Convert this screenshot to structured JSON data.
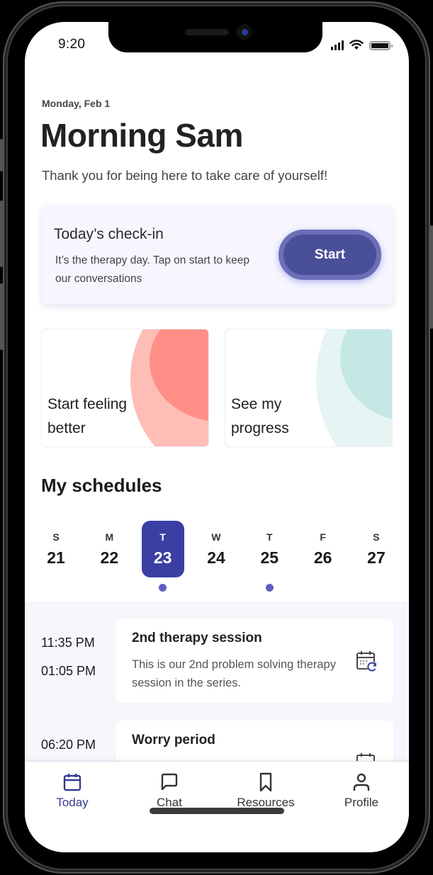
{
  "status_bar": {
    "time": "9:20",
    "icons": [
      "cellular-signal-icon",
      "wifi-icon",
      "battery-icon"
    ]
  },
  "header": {
    "date": "Monday, Feb 1",
    "greeting": "Morning Sam",
    "subtitle": "Thank you for being here to take care of yourself!"
  },
  "checkin": {
    "title": "Today’s check-in",
    "description": "It’s the therapy day. Tap on start to keep our conversations",
    "button_label": "Start"
  },
  "tiles": [
    {
      "label": "Start feeling better",
      "accent": "#ff8f86",
      "accent_light": "#ffbdb7"
    },
    {
      "label": "See my progress",
      "accent": "#c5e8e4",
      "accent_light": "#e6f5f3"
    }
  ],
  "schedules": {
    "title": "My schedules",
    "week": [
      {
        "letter": "S",
        "day": "21",
        "selected": false,
        "has_event": false
      },
      {
        "letter": "M",
        "day": "22",
        "selected": false,
        "has_event": false
      },
      {
        "letter": "T",
        "day": "23",
        "selected": true,
        "has_event": true
      },
      {
        "letter": "W",
        "day": "24",
        "selected": false,
        "has_event": false
      },
      {
        "letter": "T",
        "day": "25",
        "selected": false,
        "has_event": true
      },
      {
        "letter": "F",
        "day": "26",
        "selected": false,
        "has_event": false
      },
      {
        "letter": "S",
        "day": "27",
        "selected": false,
        "has_event": false
      }
    ],
    "events": [
      {
        "start": "11:35 PM",
        "end": "01:05 PM",
        "title": "2nd therapy session",
        "description": "This is our 2nd problem solving therapy session in the series.",
        "icon": "calendar-sync-icon"
      },
      {
        "start": "06:20 PM",
        "end": "",
        "title": "Worry period",
        "description": "",
        "icon": "calendar-icon"
      }
    ]
  },
  "bottom_nav": {
    "items": [
      {
        "label": "Today",
        "icon": "calendar-icon",
        "active": true
      },
      {
        "label": "Chat",
        "icon": "chat-bubble-icon",
        "active": false
      },
      {
        "label": "Resources",
        "icon": "bookmark-icon",
        "active": false
      },
      {
        "label": "Profile",
        "icon": "user-icon",
        "active": false
      }
    ]
  },
  "colors": {
    "primary": "#3b3fa3",
    "button": "#4a4f99",
    "dot": "#5c5fc0",
    "schedule_bg": "#f6f6fd",
    "card_bg": "#f7f6fe"
  }
}
